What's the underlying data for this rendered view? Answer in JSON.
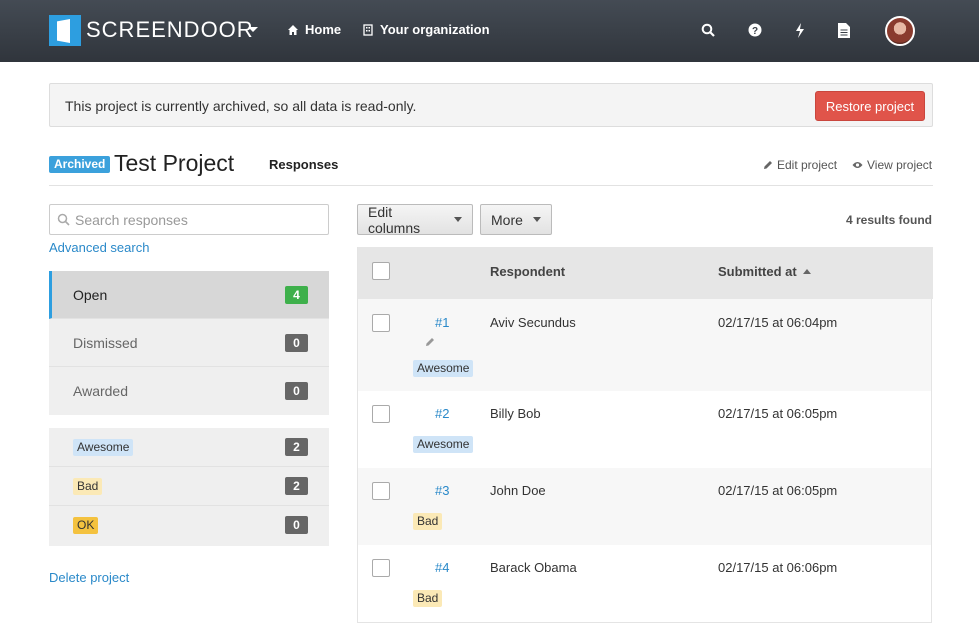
{
  "nav": {
    "brand": "SCREENDOOR",
    "links": [
      {
        "label": "Home",
        "icon": "home-icon"
      },
      {
        "label": "Your organization",
        "icon": "building-icon"
      }
    ],
    "tools": [
      "search-icon",
      "help-icon",
      "lightning-icon",
      "document-icon"
    ]
  },
  "notice": {
    "text": "This project is currently archived, so all data is read-only.",
    "restore_label": "Restore project"
  },
  "project": {
    "badge": "Archived",
    "title": "Test Project",
    "tab": "Responses",
    "edit_label": "Edit project",
    "view_label": "View project"
  },
  "sidebar": {
    "search_placeholder": "Search responses",
    "advanced_search": "Advanced search",
    "statuses": [
      {
        "label": "Open",
        "count": "4"
      },
      {
        "label": "Dismissed",
        "count": "0"
      },
      {
        "label": "Awarded",
        "count": "0"
      }
    ],
    "labels": [
      {
        "label": "Awesome",
        "count": "2"
      },
      {
        "label": "Bad",
        "count": "2"
      },
      {
        "label": "OK",
        "count": "0"
      }
    ],
    "delete_project": "Delete project"
  },
  "toolbar": {
    "edit_columns": "Edit columns",
    "more": "More",
    "results": "4 results found"
  },
  "table": {
    "headers": {
      "respondent": "Respondent",
      "submitted": "Submitted at"
    },
    "rows": [
      {
        "id": "#1",
        "name": "Aviv Secundus",
        "date": "02/17/15 at 06:04pm",
        "tag": "Awesome"
      },
      {
        "id": "#2",
        "name": "Billy Bob",
        "date": "02/17/15 at 06:05pm",
        "tag": "Awesome"
      },
      {
        "id": "#3",
        "name": "John Doe",
        "date": "02/17/15 at 06:05pm",
        "tag": "Bad"
      },
      {
        "id": "#4",
        "name": "Barack Obama",
        "date": "02/17/15 at 06:06pm",
        "tag": "Bad"
      }
    ]
  },
  "colors": {
    "accent": "#2d9ee0",
    "danger": "#e0544a",
    "open_count": "#3eb04b",
    "link": "#2a89c9"
  }
}
